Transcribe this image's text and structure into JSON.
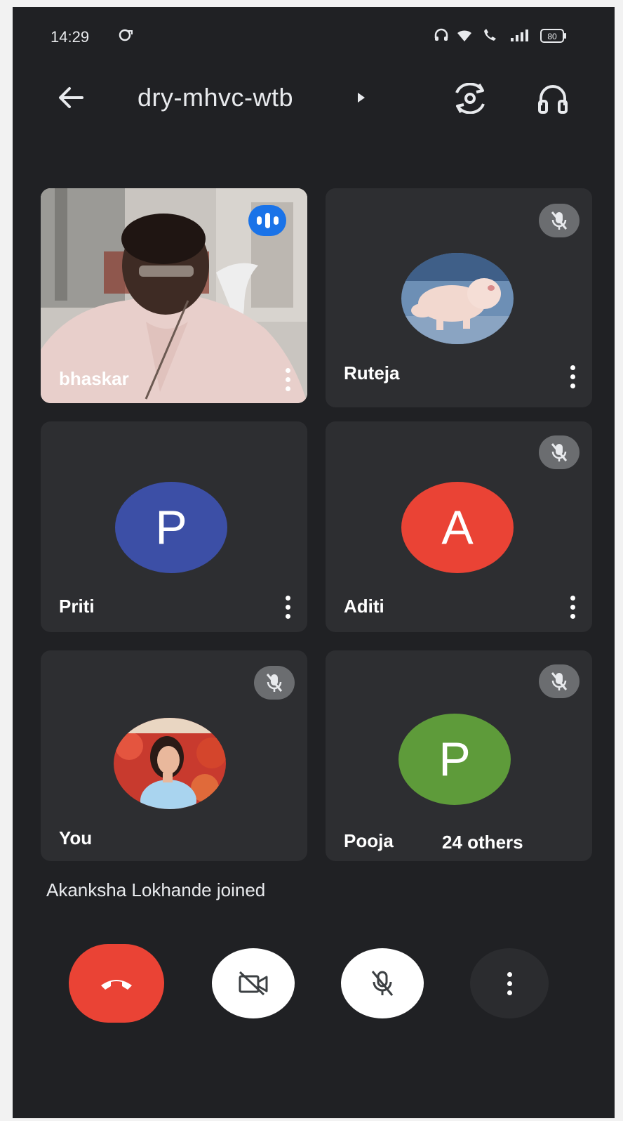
{
  "status_bar": {
    "time": "14:29",
    "battery": "80"
  },
  "meeting": {
    "code": "dry-mhvc-wtb"
  },
  "tiles": [
    {
      "name": "bhaskar"
    },
    {
      "name": "Ruteja"
    },
    {
      "name": "Priti",
      "initial": "P"
    },
    {
      "name": "Aditi",
      "initial": "A"
    },
    {
      "name": "You"
    },
    {
      "name": "Pooja",
      "initial": "P",
      "others": "24 others"
    }
  ],
  "toast": "Akanksha Lokhande joined",
  "icons": {
    "back": "arrow-left-icon",
    "camera_switch": "camera-switch-icon",
    "audio": "headphones-icon",
    "mic_off": "mic-off-icon",
    "speaking": "speaking-indicator-icon",
    "end_call": "phone-hangup-icon",
    "camera_off": "video-off-icon",
    "more": "more-vert-icon"
  },
  "colors": {
    "background": "#202124",
    "tile": "#2d2e31",
    "end_call": "#ea4335",
    "avatar_priti": "#3c4fa6",
    "avatar_aditi": "#ea4335",
    "avatar_pooja": "#5e9b3a",
    "speaking": "#1a73e8"
  }
}
